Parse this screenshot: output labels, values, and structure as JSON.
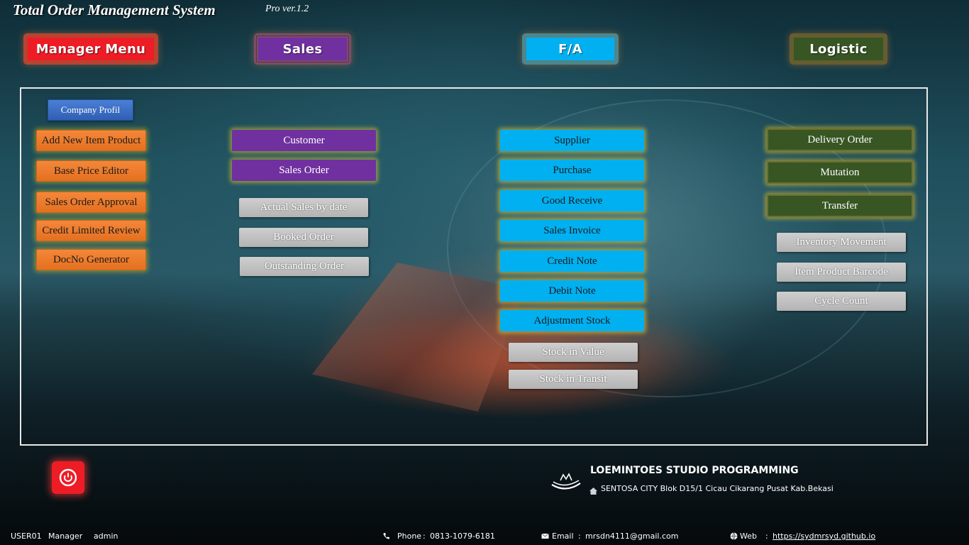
{
  "app": {
    "title": "Total Order Management System",
    "version": "Pro ver.1.2"
  },
  "tabs": {
    "manager": "Manager Menu",
    "sales": "Sales",
    "fa": "F/A",
    "logistic": "Logistic"
  },
  "manager_menu": {
    "company_profil": "Company Profil",
    "add_new_item_product": "Add New Item Product",
    "base_price_editor": "Base Price Editor",
    "sales_order_approval": "Sales Order Approval",
    "credit_limited_review": "Credit Limited Review",
    "docno_generator": "DocNo Generator"
  },
  "sales_menu": {
    "customer": "Customer",
    "sales_order": "Sales Order",
    "actual_sales_by_date": "Actual Sales by date",
    "booked_order": "Booked Order",
    "outstanding_order": "Outstanding Order"
  },
  "fa_menu": {
    "supplier": "Supplier",
    "purchase": "Purchase",
    "good_receive": "Good Receive",
    "sales_invoice": "Sales Invoice",
    "credit_note": "Credit Note",
    "debit_note": "Debit Note",
    "adjustment_stock": "Adjustment Stock",
    "stock_in_value": "Stock in Value",
    "stock_in_transit": "Stock in Transit"
  },
  "logistic_menu": {
    "delivery_order": "Delivery Order",
    "mutation": "Mutation",
    "transfer": "Transfer",
    "inventory_movement": "Inventory Movement",
    "item_product_barcode": "Item Product Barcode",
    "cycle_count": "Cycle Count"
  },
  "footer": {
    "studio_name": "LOEMINTOES STUDIO PROGRAMMING",
    "address": "SENTOSA CITY Blok D15/1 Cicau Cikarang Pusat Kab.Bekasi",
    "user_id": "USER01",
    "role": "Manager",
    "username": "admin",
    "phone_label": "Phone",
    "phone_sep": ":",
    "phone_value": "0813-1079-6181",
    "email_label": "Email",
    "email_sep": ":",
    "email_value": "mrsdn4111@gmail.com",
    "web_label": "Web",
    "web_sep": ":",
    "web_value": "https://sydmrsyd.github.io"
  },
  "colors": {
    "manager_red": "#ee1c25",
    "sales_purple": "#7030a0",
    "fa_cyan": "#00b0f0",
    "logistic_green": "#375623",
    "manager_orange": "#f4873a",
    "report_gray": "#bfbfbf"
  },
  "icons": {
    "power": "power-icon",
    "logo": "studio-logo-icon",
    "address": "home-icon",
    "phone": "phone-icon",
    "email": "envelope-icon",
    "web": "globe-icon"
  }
}
